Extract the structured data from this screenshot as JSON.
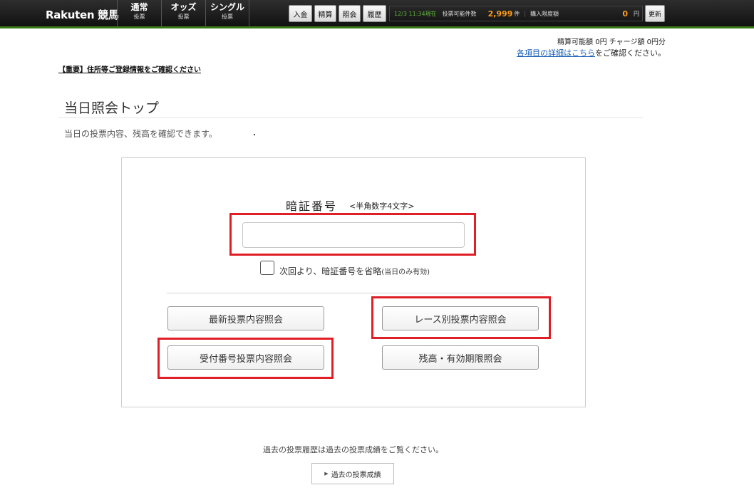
{
  "header": {
    "logo": "Rakuten 競馬",
    "nav": [
      {
        "main": "通常",
        "sub": "投票"
      },
      {
        "main": "オッズ",
        "sub": "投票"
      },
      {
        "main": "シングル",
        "sub": "投票"
      }
    ],
    "buttons": {
      "deposit": "入金",
      "settle": "精算",
      "inquiry": "照会",
      "history": "履歴"
    },
    "status": {
      "time": "12/3 11:34現在",
      "votable_label": "投票可能件数",
      "votable_count": "2,999",
      "votable_unit": "件",
      "limit_label": "購入限度額",
      "limit_amount": "0",
      "limit_unit": "円"
    },
    "refresh": "更新"
  },
  "balance": "精算可能額 0円 チャージ額 0円分",
  "detail": {
    "link": "各項目の詳細はこちら",
    "rest": "をご確認ください。"
  },
  "notice": "【重要】住所等ご登録情報をご確認ください",
  "page_title": "当日照会トップ",
  "description": "当日の投票内容、残高を確認できます。",
  "dot": "・",
  "form": {
    "pin_label": "暗証番号",
    "pin_hint": "<半角数字4文字>",
    "pin_value": "",
    "remember_label": "次回より、暗証番号を省略",
    "remember_note": "(当日のみ有効)",
    "buttons": {
      "latest": "最新投票内容照会",
      "by_race": "レース別投票内容照会",
      "by_receipt": "受付番号投票内容照会",
      "balance": "残高・有効期限照会"
    }
  },
  "past": {
    "text": "過去の投票履歴は過去の投票成績をご覧ください。",
    "button": "過去の投票成績"
  },
  "colors": {
    "highlight": "#e01e26",
    "accent_green": "#3a7a17",
    "count_orange": "#ff9c1a",
    "link_blue": "#1a5fb4"
  }
}
